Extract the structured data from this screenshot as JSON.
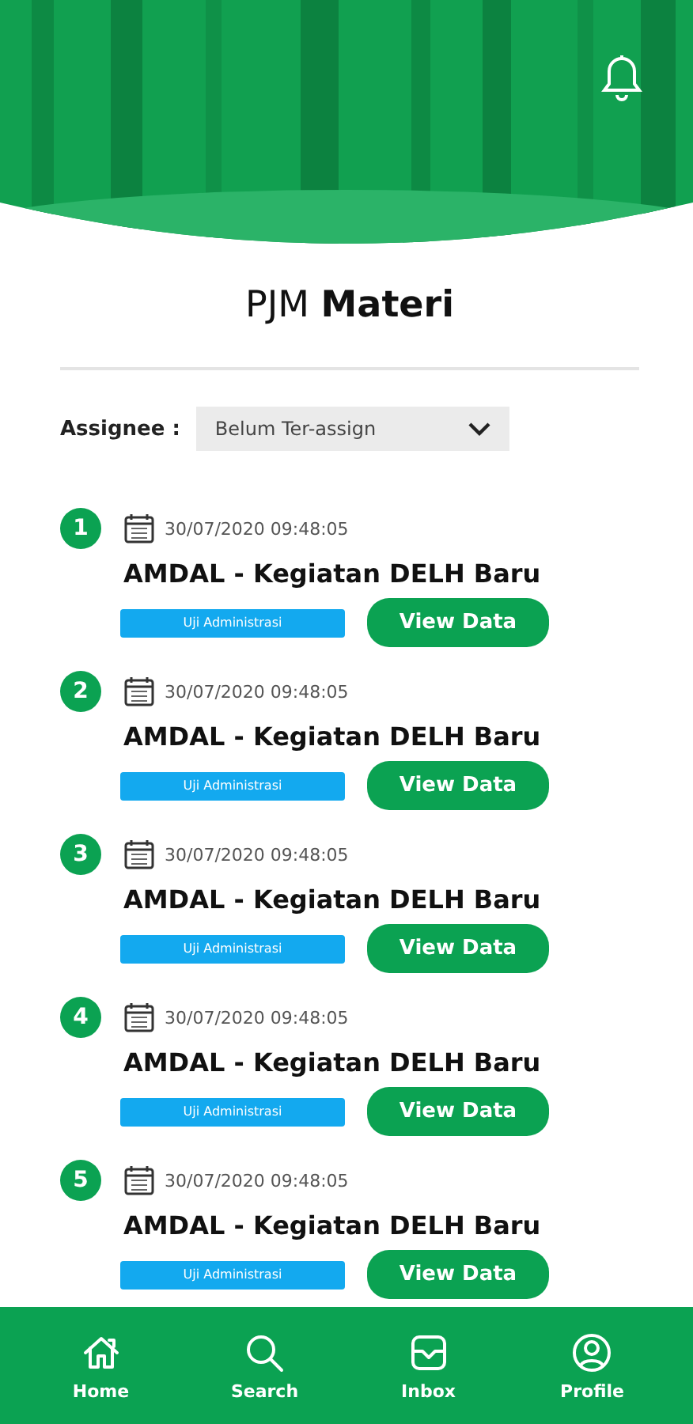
{
  "title": {
    "prefix": "PJM",
    "bold": "Materi"
  },
  "assignee": {
    "label": "Assignee :",
    "value": "Belum Ter-assign"
  },
  "items": [
    {
      "number": "1",
      "date": "30/07/2020 09:48:05",
      "title": "AMDAL - Kegiatan DELH Baru",
      "status": "Uji Administrasi",
      "action": "View Data"
    },
    {
      "number": "2",
      "date": "30/07/2020 09:48:05",
      "title": "AMDAL - Kegiatan DELH Baru",
      "status": "Uji Administrasi",
      "action": "View Data"
    },
    {
      "number": "3",
      "date": "30/07/2020 09:48:05",
      "title": "AMDAL - Kegiatan DELH Baru",
      "status": "Uji Administrasi",
      "action": "View Data"
    },
    {
      "number": "4",
      "date": "30/07/2020 09:48:05",
      "title": "AMDAL - Kegiatan DELH Baru",
      "status": "Uji Administrasi",
      "action": "View Data"
    },
    {
      "number": "5",
      "date": "30/07/2020 09:48:05",
      "title": "AMDAL - Kegiatan DELH Baru",
      "status": "Uji Administrasi",
      "action": "View Data"
    }
  ],
  "nav": [
    {
      "kind": "home",
      "label": "Home"
    },
    {
      "kind": "search",
      "label": "Search"
    },
    {
      "kind": "inbox",
      "label": "Inbox"
    },
    {
      "kind": "profile",
      "label": "Profile"
    }
  ]
}
